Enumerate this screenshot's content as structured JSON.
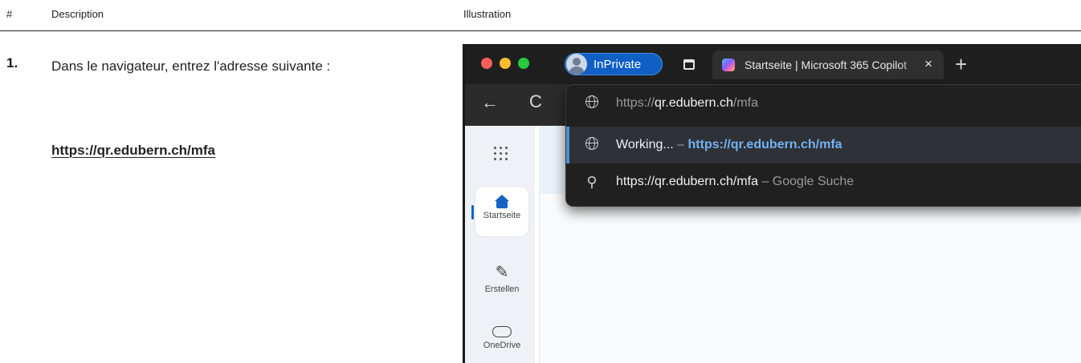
{
  "table": {
    "col_num": "#",
    "col_desc": "Description",
    "col_ill": "Illustration"
  },
  "step": {
    "number": "1.",
    "text": "Dans le navigateur, entrez l'adresse suivante :",
    "url": "https://qr.edubern.ch/mfa"
  },
  "browser": {
    "profile_label": "InPrivate",
    "tab_title": "Startseite | Microsoft 365 Copilot",
    "tab_close": "×",
    "new_tab": "+",
    "back": "←",
    "reload": "C",
    "address": {
      "scheme": "https://",
      "host": "qr.edubern.ch",
      "path": "/mfa"
    },
    "suggestions": [
      {
        "prefix": "Working...",
        "sep": " – ",
        "link": "https://qr.edubern.ch/mfa",
        "icon": "globe-icon"
      },
      {
        "prefix": "https://qr.edubern.ch/mfa",
        "sep": " – ",
        "link": "Google Suche",
        "icon": "search-icon"
      }
    ],
    "sidebar": [
      {
        "label": "Startseite",
        "icon": "home-icon"
      },
      {
        "label": "Erstellen",
        "icon": "pen-icon"
      },
      {
        "label": "OneDrive",
        "icon": "cloud-icon"
      }
    ]
  }
}
